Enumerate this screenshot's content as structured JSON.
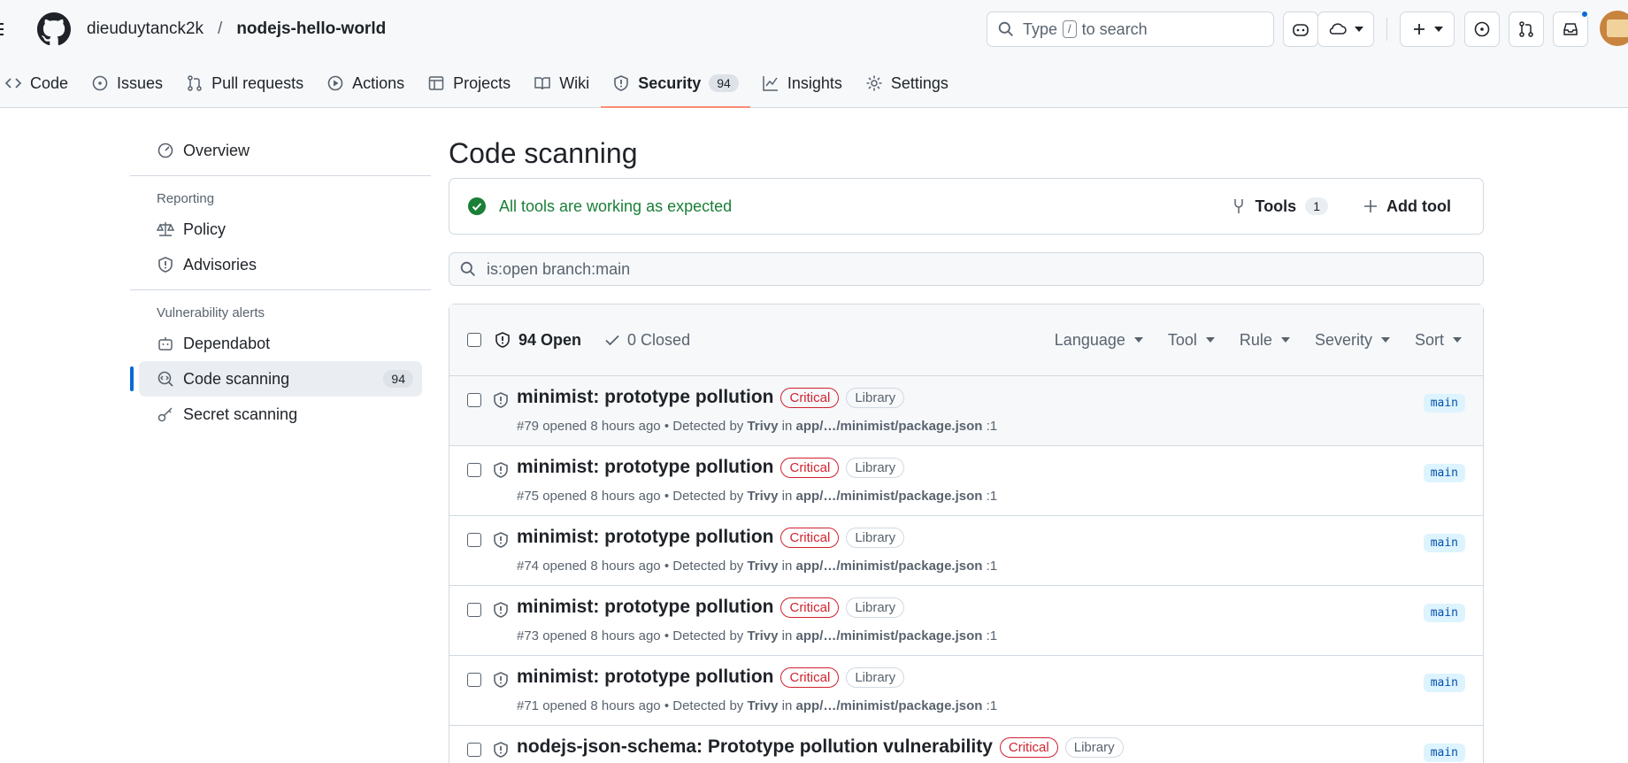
{
  "header": {
    "owner": "dieuduytanck2k",
    "separator": "/",
    "repo": "nodejs-hello-world",
    "search_before": "Type",
    "search_key": "/",
    "search_after": "to search"
  },
  "tabs": [
    {
      "label": "Code",
      "icon": "code-icon"
    },
    {
      "label": "Issues",
      "icon": "issue-icon"
    },
    {
      "label": "Pull requests",
      "icon": "pull-request-icon"
    },
    {
      "label": "Actions",
      "icon": "play-icon"
    },
    {
      "label": "Projects",
      "icon": "table-icon"
    },
    {
      "label": "Wiki",
      "icon": "book-icon"
    },
    {
      "label": "Security",
      "icon": "shield-icon",
      "count": "94",
      "active": true
    },
    {
      "label": "Insights",
      "icon": "graph-icon"
    },
    {
      "label": "Settings",
      "icon": "gear-icon"
    }
  ],
  "sidebar": {
    "overview": "Overview",
    "reporting_heading": "Reporting",
    "policy": "Policy",
    "advisories": "Advisories",
    "vuln_heading": "Vulnerability alerts",
    "dependabot": "Dependabot",
    "code_scanning": "Code scanning",
    "code_scanning_count": "94",
    "secret_scanning": "Secret scanning"
  },
  "main": {
    "title": "Code scanning",
    "status": "All tools are working as expected",
    "tools_label": "Tools",
    "tools_count": "1",
    "add_tool": "Add tool",
    "filter_value": "is:open branch:main",
    "open_label": "94 Open",
    "closed_label": "0 Closed",
    "filters": [
      "Language",
      "Tool",
      "Rule",
      "Severity",
      "Sort"
    ]
  },
  "alerts": [
    {
      "title": "minimist: prototype pollution",
      "severity": "Critical",
      "tag": "Library",
      "number": "#79",
      "opened": "opened 8 hours ago • Detected by",
      "tool": "Trivy",
      "in": "in",
      "path": "app/…/minimist/package.json",
      "line": ":1",
      "branch": "main"
    },
    {
      "title": "minimist: prototype pollution",
      "severity": "Critical",
      "tag": "Library",
      "number": "#75",
      "opened": "opened 8 hours ago • Detected by",
      "tool": "Trivy",
      "in": "in",
      "path": "app/…/minimist/package.json",
      "line": ":1",
      "branch": "main"
    },
    {
      "title": "minimist: prototype pollution",
      "severity": "Critical",
      "tag": "Library",
      "number": "#74",
      "opened": "opened 8 hours ago • Detected by",
      "tool": "Trivy",
      "in": "in",
      "path": "app/…/minimist/package.json",
      "line": ":1",
      "branch": "main"
    },
    {
      "title": "minimist: prototype pollution",
      "severity": "Critical",
      "tag": "Library",
      "number": "#73",
      "opened": "opened 8 hours ago • Detected by",
      "tool": "Trivy",
      "in": "in",
      "path": "app/…/minimist/package.json",
      "line": ":1",
      "branch": "main"
    },
    {
      "title": "minimist: prototype pollution",
      "severity": "Critical",
      "tag": "Library",
      "number": "#71",
      "opened": "opened 8 hours ago • Detected by",
      "tool": "Trivy",
      "in": "in",
      "path": "app/…/minimist/package.json",
      "line": ":1",
      "branch": "main"
    },
    {
      "title": "nodejs-json-schema: Prototype pollution vulnerability",
      "severity": "Critical",
      "tag": "Library",
      "number": "",
      "opened": "",
      "tool": "",
      "in": "",
      "path": "",
      "line": "",
      "branch": "main"
    }
  ]
}
